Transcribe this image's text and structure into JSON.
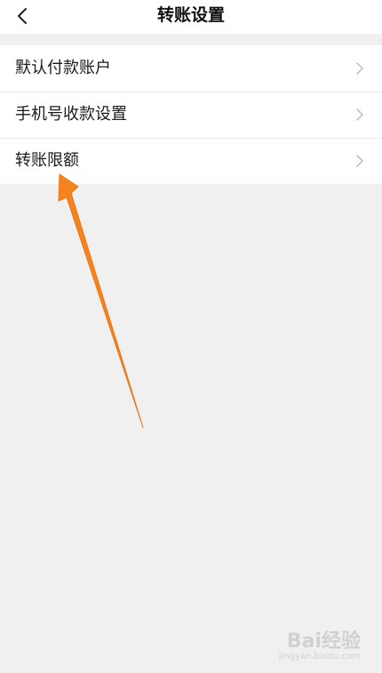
{
  "header": {
    "title": "转账设置",
    "back_icon": "chevron-left-icon"
  },
  "settings": {
    "items": [
      {
        "label": "默认付款账户",
        "icon": "chevron-right-icon"
      },
      {
        "label": "手机号收款设置",
        "icon": "chevron-right-icon"
      },
      {
        "label": "转账限额",
        "icon": "chevron-right-icon"
      }
    ]
  },
  "annotation": {
    "color": "#F5841F",
    "icon": "pointer-arrow"
  },
  "watermark": {
    "logo": "Bai经验",
    "url": "jingyan.baidu.com"
  }
}
